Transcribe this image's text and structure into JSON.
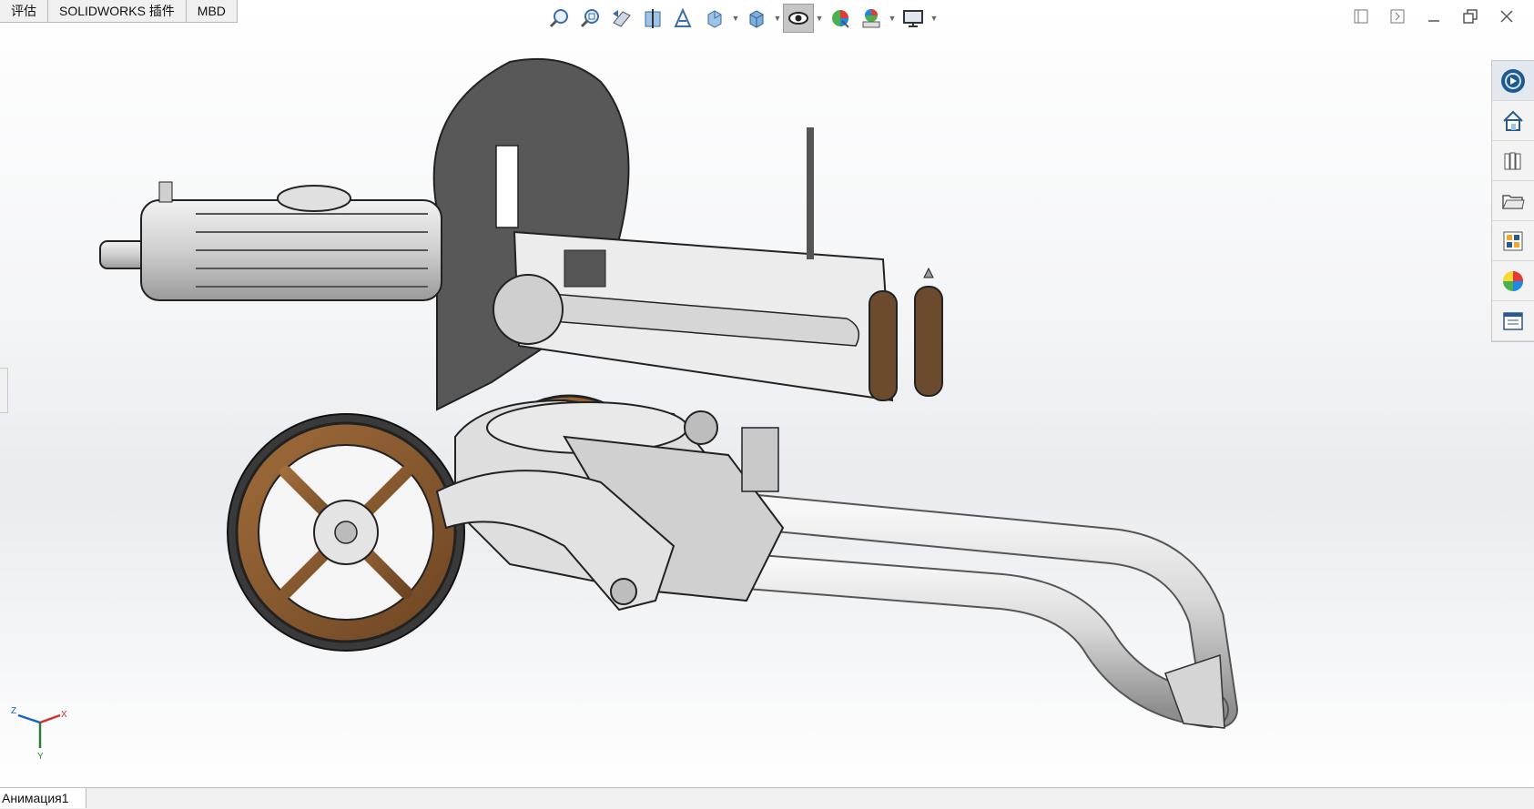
{
  "command_tabs": [
    "评估",
    "SOLIDWORKS 插件",
    "MBD"
  ],
  "hud_toolbar": [
    {
      "icon": "zoom-to-fit-icon"
    },
    {
      "icon": "zoom-to-area-icon"
    },
    {
      "icon": "previous-view-icon"
    },
    {
      "icon": "section-view-icon"
    },
    {
      "icon": "dynamic-annotation-views-icon"
    },
    {
      "icon": "view-orientation-icon",
      "dropdown": true
    },
    {
      "icon": "display-style-icon",
      "dropdown": true
    },
    {
      "icon": "hide-show-items-icon",
      "dropdown": true,
      "active": true
    },
    {
      "icon": "edit-appearance-icon"
    },
    {
      "icon": "apply-scene-icon",
      "dropdown": true
    },
    {
      "icon": "view-settings-icon",
      "dropdown": true
    }
  ],
  "window_controls": [
    "tile-left-icon",
    "tile-right-icon",
    "minimize-icon",
    "restore-icon",
    "close-icon"
  ],
  "task_pane": [
    "solidworks-resources-icon",
    "home-icon",
    "design-library-icon",
    "file-explorer-icon",
    "view-palette-icon",
    "appearances-scenes-icon",
    "custom-properties-icon"
  ],
  "bottom_tabs": [
    "Анимация1"
  ],
  "triad_axes": [
    "Z",
    "X",
    "Y"
  ],
  "colors": {
    "model_metal": "#d9d9d9",
    "shield": "#555555",
    "wood": "#8b5e34",
    "handle": "#6b4a2e",
    "axis_x": "#d32f2f",
    "axis_y": "#2e7d32",
    "axis_z": "#1565c0"
  }
}
